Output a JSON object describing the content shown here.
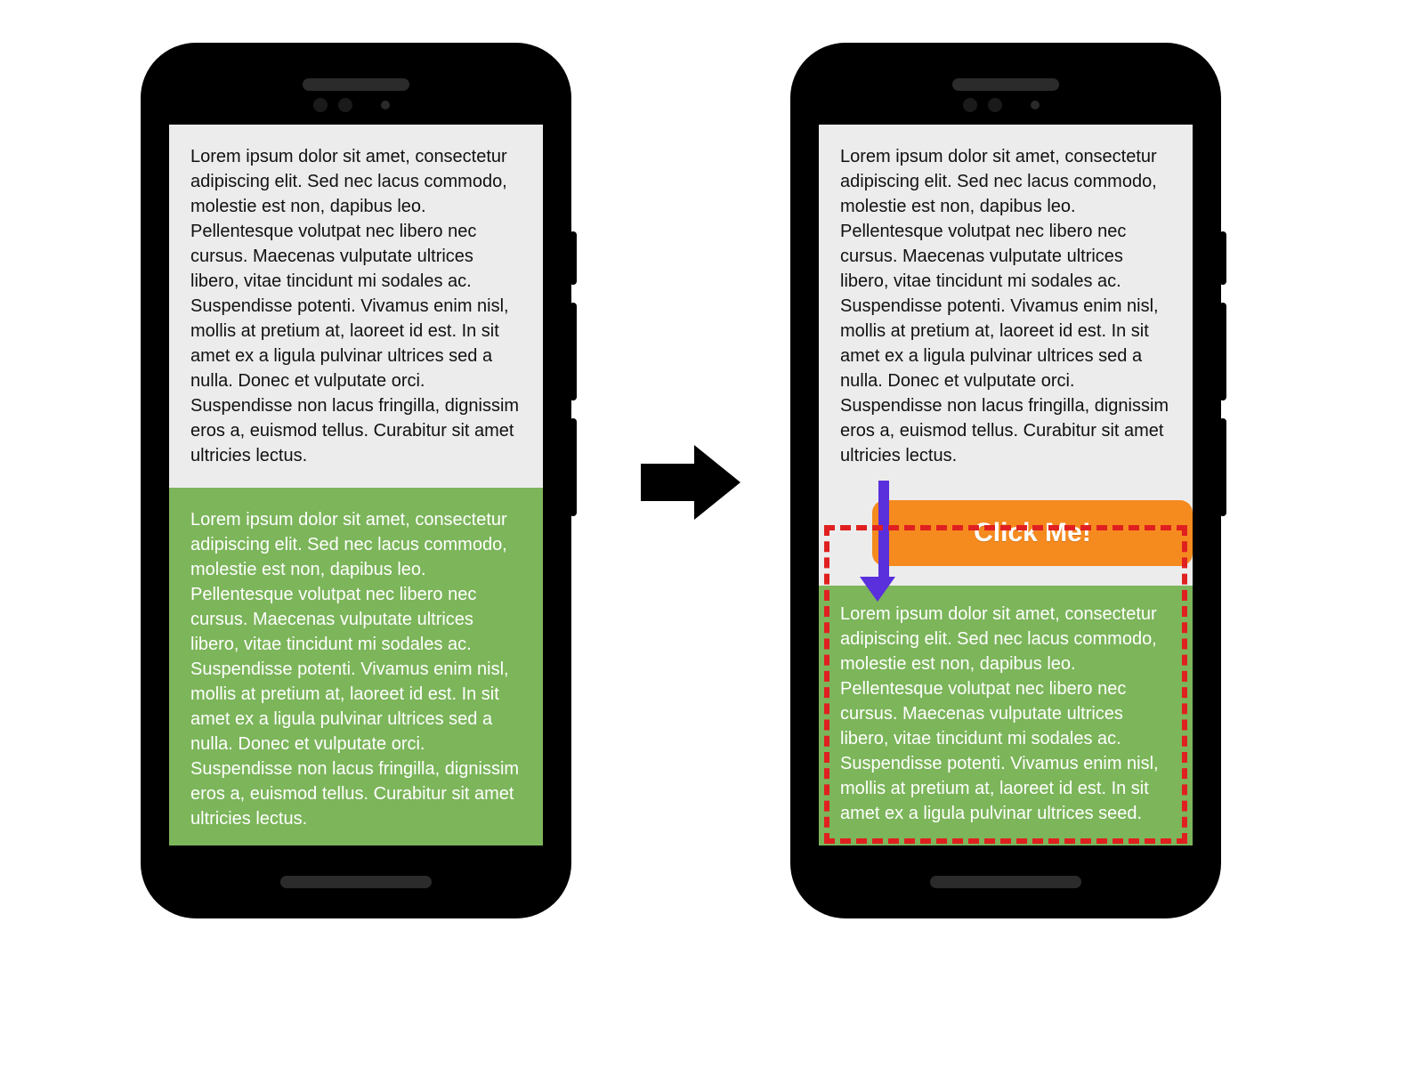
{
  "left_phone": {
    "paragraph_top": "Lorem ipsum dolor sit amet, consectetur adipiscing elit. Sed nec lacus commodo, molestie est non, dapibus leo. Pellentesque volutpat nec libero nec cursus. Maecenas vulputate ultrices libero, vitae tincidunt mi sodales ac. Suspendisse potenti. Vivamus enim nisl, mollis at pretium at, laoreet id est. In sit amet ex a ligula pulvinar ultrices sed a nulla. Donec et vulputate orci. Suspendisse non lacus fringilla, dignissim eros a, euismod tellus. Curabitur sit amet ultricies lectus.",
    "paragraph_bottom": "Lorem ipsum dolor sit amet, consectetur adipiscing elit. Sed nec lacus commodo, molestie est non, dapibus leo. Pellentesque volutpat nec libero nec cursus. Maecenas vulputate ultrices libero, vitae tincidunt mi sodales ac. Suspendisse potenti. Vivamus enim nisl, mollis at pretium at, laoreet id est. In sit amet ex a ligula pulvinar ultrices sed a nulla. Donec et vulputate orci. Suspendisse non lacus fringilla, dignissim eros a, euismod tellus. Curabitur sit amet ultricies lectus."
  },
  "right_phone": {
    "paragraph_top": "Lorem ipsum dolor sit amet, consectetur adipiscing elit. Sed nec lacus commodo, molestie est non, dapibus leo. Pellentesque volutpat nec libero nec cursus. Maecenas vulputate ultrices libero, vitae tincidunt mi sodales ac. Suspendisse potenti. Vivamus enim nisl, mollis at pretium at, laoreet id est. In sit amet ex a ligula pulvinar ultrices sed a nulla. Donec et vulputate orci. Suspendisse non lacus fringilla, dignissim eros a, euismod tellus. Curabitur sit amet ultricies lectus.",
    "button_label": "Click Me!",
    "paragraph_bottom": "Lorem ipsum dolor sit amet, consectetur adipiscing elit. Sed nec lacus commodo, molestie est non, dapibus leo. Pellentesque volutpat nec libero nec cursus. Maecenas vulputate ultrices libero, vitae tincidunt mi sodales ac. Suspendisse potenti. Vivamus enim nisl, mollis at pretium at, laoreet id est. In sit amet ex a ligula pulvinar ultrices seed."
  },
  "colors": {
    "button_bg": "#f58a1f",
    "green_bg": "#7cb55a",
    "highlight_dash": "#e02020",
    "arrow_purple": "#5a2fdc"
  }
}
